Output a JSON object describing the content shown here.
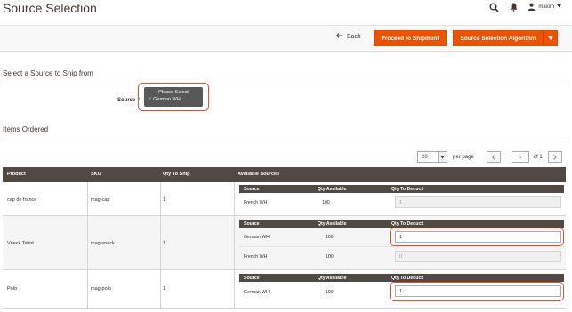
{
  "page": {
    "title": "Source Selection"
  },
  "header": {
    "username": "maxim",
    "icons": [
      "search-icon",
      "bell-icon",
      "user-icon"
    ]
  },
  "actions": {
    "back_label": "Back",
    "proceed_label": "Proceed to Shipment",
    "algorithm_label": "Source Selection Algorithm"
  },
  "source_section": {
    "title": "Select a Source to Ship from",
    "label": "Source",
    "required_marker": "*",
    "options": [
      "-- Please Select --",
      "German WH"
    ],
    "selected_mark": "✓",
    "selected": "German WH"
  },
  "items_section": {
    "title": "Items Ordered"
  },
  "pager": {
    "per_page_value": "20",
    "per_page_label": "per page",
    "current_page": "1",
    "of_pages": "of 1"
  },
  "grid": {
    "columns": [
      "Product",
      "SKU",
      "Qty To Ship",
      "Available Sources"
    ],
    "inner_columns": [
      "Source",
      "Qty Available",
      "Qty To Deduct"
    ],
    "rows": [
      {
        "product": "cap de france",
        "sku": "mag-cap",
        "qty_to_ship": "1",
        "sources": [
          {
            "source": "French WH",
            "qty_available": "100",
            "qty_to_deduct": "1",
            "disabled": true
          }
        ]
      },
      {
        "product": "Vneck Tshirt",
        "sku": "mag-vneck",
        "qty_to_ship": "1",
        "sources": [
          {
            "source": "German WH",
            "qty_available": "100",
            "qty_to_deduct": "1",
            "disabled": false
          },
          {
            "source": "French WH",
            "qty_available": "100",
            "qty_to_deduct": "0",
            "disabled": true
          }
        ]
      },
      {
        "product": "Polo",
        "sku": "mag-polo",
        "qty_to_ship": "1",
        "sources": [
          {
            "source": "German WH",
            "qty_available": "100",
            "qty_to_deduct": "1",
            "disabled": false
          }
        ]
      }
    ]
  },
  "colors": {
    "accent": "#eb5202",
    "grid_header": "#514943",
    "highlight": "#e0502a"
  }
}
